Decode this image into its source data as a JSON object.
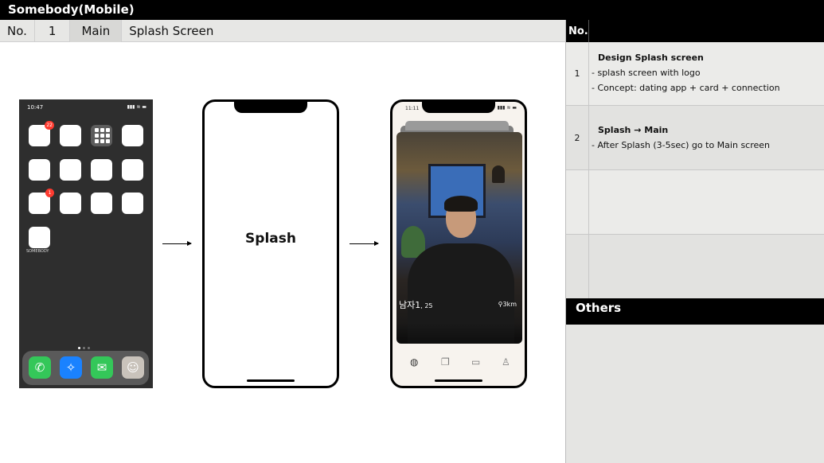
{
  "header": {
    "title": "Somebody(Mobile)"
  },
  "breadcrumb": {
    "no_label": "No.",
    "no_value": "1",
    "section": "Main",
    "page": "Splash Screen"
  },
  "home_screen": {
    "time": "10:47",
    "status_icons": "▮▮▮ ≋ ▬",
    "badges": [
      "22",
      "1"
    ],
    "app_label": "SOMEBODY",
    "dock_apps": [
      "phone-icon",
      "safari-icon",
      "messages-icon",
      "contacts-icon"
    ]
  },
  "splash": {
    "label": "Splash"
  },
  "main_screen": {
    "time": "11:11",
    "status_icons": "▮▮▮ ≋ ▬",
    "card": {
      "name": "남자1",
      "age": ", 25",
      "distance": "3km",
      "distance_icon": "location-pin-icon"
    },
    "tabs": [
      {
        "icon": "home-icon",
        "glyph": "◍"
      },
      {
        "icon": "cards-icon",
        "glyph": "❐"
      },
      {
        "icon": "chat-icon",
        "glyph": "▭"
      },
      {
        "icon": "profile-icon",
        "glyph": "♙"
      }
    ]
  },
  "panel": {
    "no_header": "No.",
    "rows": [
      {
        "number": "1",
        "title": "Design Splash screen",
        "lines": [
          "splash screen with logo",
          "Concept: dating app + card + connection"
        ]
      },
      {
        "number": "2",
        "title": "Splash → Main",
        "lines": [
          "After Splash (3-5sec) go to Main screen"
        ]
      }
    ],
    "others_title": "Others"
  },
  "colors": {
    "black": "#000000",
    "panel_gray": "#e7e7e5",
    "badge_red": "#ff3b30"
  }
}
